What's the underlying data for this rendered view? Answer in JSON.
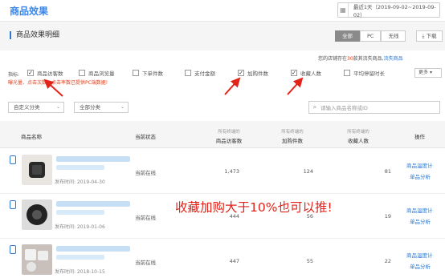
{
  "header": {
    "title": "商品效果",
    "date_range": "最近1天（2019-09-02~2019-09-02）"
  },
  "section": {
    "title": "商品效果明细",
    "segments": [
      "全部",
      "PC",
      "无线"
    ],
    "active_segment": "全部",
    "download": "下载"
  },
  "note": {
    "prefix": "您的店铺存在",
    "count": "30",
    "suffix": "款其流失商品,",
    "link": "流失商品"
  },
  "metrics": {
    "label": "指标:",
    "items": [
      {
        "label": "商品访客数",
        "checked": true
      },
      {
        "label": "商品浏览量",
        "checked": false
      },
      {
        "label": "下单件数",
        "checked": false
      },
      {
        "label": "支付金额",
        "checked": false
      },
      {
        "label": "加购件数",
        "checked": true
      },
      {
        "label": "收藏人数",
        "checked": true
      },
      {
        "label": "平均停留时长",
        "checked": false
      }
    ],
    "more": "更多",
    "hint": "曝光量、点击次数、点击率数已提供PC端数据!"
  },
  "filters": {
    "custom_category": "自定义分类",
    "all_category": "全部分类",
    "search_placeholder": "请输入商品名称或ID"
  },
  "table": {
    "headers": {
      "name": "商品名称",
      "status": "当前状态",
      "visitors_sub": "所有终端的",
      "visitors": "商品访客数",
      "carts_sub": "所有终端的",
      "carts": "加购件数",
      "favs_sub": "所有终端的",
      "favs": "收藏人数",
      "action": "操作"
    },
    "rows": [
      {
        "pubdate": "发布时间: 2019-04-30",
        "status": "当前在线",
        "visitors": "1,473",
        "carts": "124",
        "favs": "81",
        "link1": "商品温度计",
        "link2": "单品分析"
      },
      {
        "pubdate": "发布时间: 2019-01-06",
        "status": "当前在线",
        "visitors": "444",
        "carts": "56",
        "favs": "19",
        "link1": "商品温度计",
        "link2": "单品分析"
      },
      {
        "pubdate": "发布时间: 2018-10-15",
        "status": "当前在线",
        "visitors": "447",
        "carts": "55",
        "favs": "22",
        "link1": "商品温度计",
        "link2": "单品分析"
      }
    ]
  },
  "annotation": {
    "text": "收藏加购大于10%也可以推!"
  },
  "colors": {
    "brand": "#3a86e8",
    "annotation": "#e2231a",
    "link": "#2c78d4"
  }
}
